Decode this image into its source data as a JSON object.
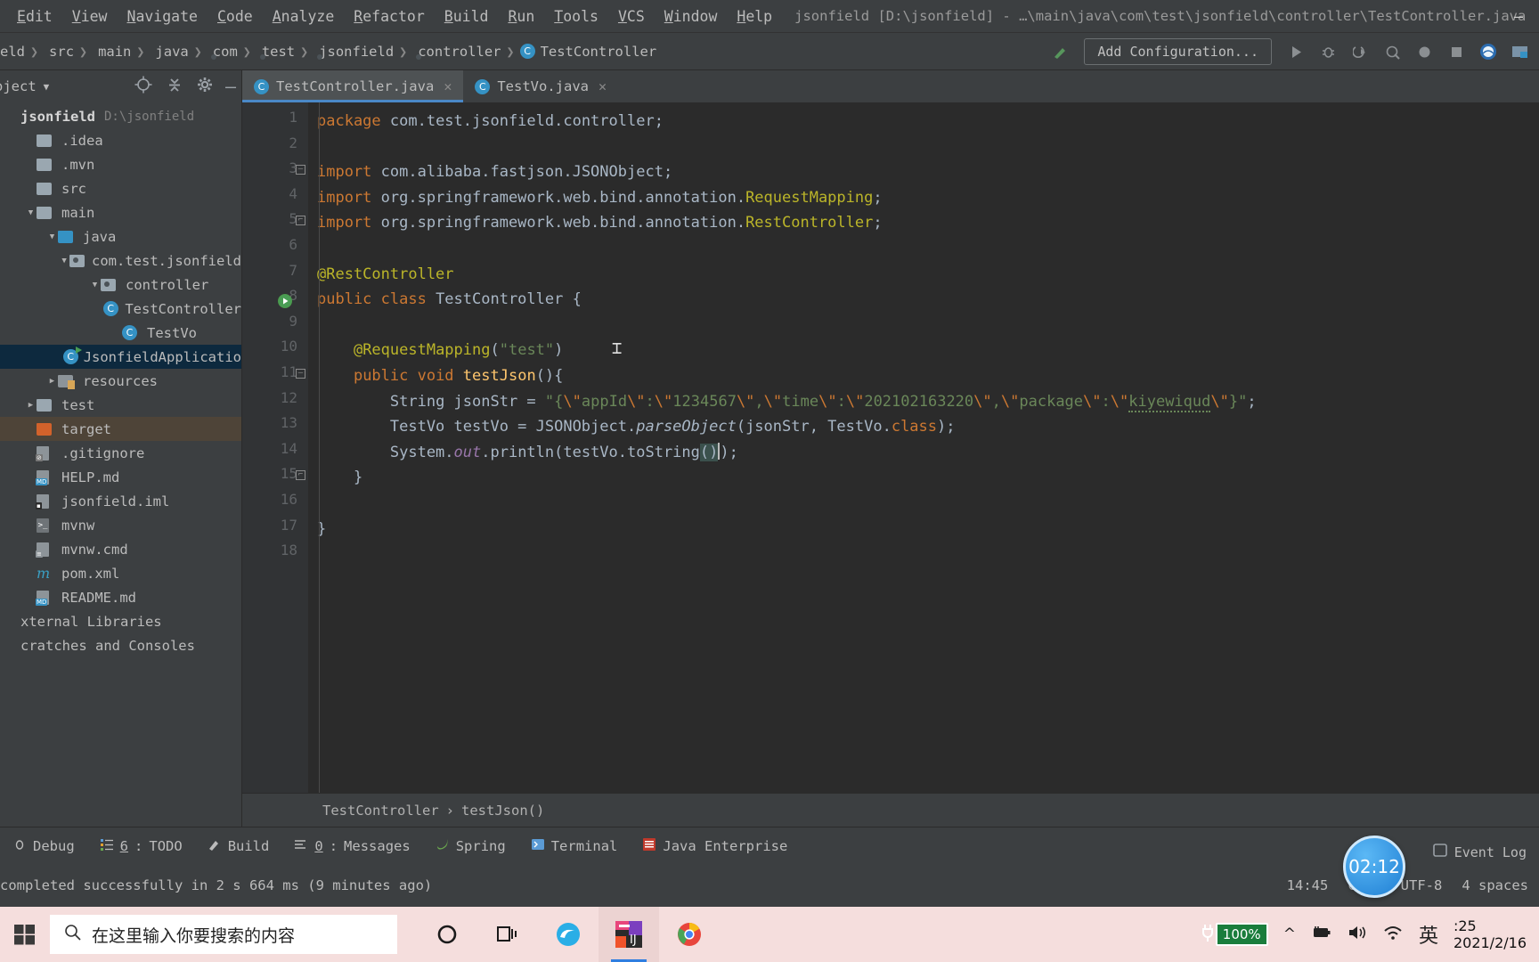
{
  "titlebar": {
    "menus": [
      "Edit",
      "View",
      "Navigate",
      "Code",
      "Analyze",
      "Refactor",
      "Build",
      "Run",
      "Tools",
      "VCS",
      "Window",
      "Help"
    ],
    "window_title": "jsonfield [D:\\jsonfield] - …\\main\\java\\com\\test\\jsonfield\\controller\\TestController.java",
    "minimize": "—"
  },
  "navbar": {
    "crumbs": [
      {
        "label": "eld",
        "icon": "none"
      },
      {
        "label": "src",
        "icon": "folder"
      },
      {
        "label": "main",
        "icon": "folder"
      },
      {
        "label": "java",
        "icon": "folder-blue"
      },
      {
        "label": "com",
        "icon": "package"
      },
      {
        "label": "test",
        "icon": "package"
      },
      {
        "label": "jsonfield",
        "icon": "package"
      },
      {
        "label": "controller",
        "icon": "package"
      },
      {
        "label": "TestController",
        "icon": "class"
      }
    ],
    "add_configuration": "Add Configuration...",
    "icons": [
      "build-hammer-icon",
      "run-icon",
      "debug-icon",
      "run-coverage-icon",
      "profile-icon",
      "record-icon",
      "stop-icon",
      "search-everywhere-icon",
      "project-structure-icon"
    ]
  },
  "sidebar": {
    "title": "oject",
    "header_icons": [
      "locate-icon",
      "collapse-all-icon",
      "settings-gear-icon",
      "hide-icon"
    ],
    "tree": [
      {
        "label": "jsonfield",
        "path": "D:\\jsonfield",
        "indent": 0,
        "arrow": "",
        "icon": "project",
        "sel": ""
      },
      {
        "label": ".idea",
        "indent": 1,
        "arrow": "",
        "icon": "folder",
        "sel": ""
      },
      {
        "label": ".mvn",
        "indent": 1,
        "arrow": "",
        "icon": "folder",
        "sel": ""
      },
      {
        "label": "src",
        "indent": 1,
        "arrow": "",
        "icon": "folder",
        "sel": ""
      },
      {
        "label": "main",
        "indent": 1,
        "arrow": "▼",
        "icon": "folder",
        "sel": ""
      },
      {
        "label": "java",
        "indent": 2,
        "arrow": "▼",
        "icon": "folder-blue",
        "sel": ""
      },
      {
        "label": "com.test.jsonfield",
        "indent": 3,
        "arrow": "▼",
        "icon": "package",
        "sel": ""
      },
      {
        "label": "controller",
        "indent": 4,
        "arrow": "▼",
        "icon": "package",
        "sel": ""
      },
      {
        "label": "TestController",
        "indent": 5,
        "arrow": "",
        "icon": "class",
        "sel": ""
      },
      {
        "label": "TestVo",
        "indent": 5,
        "arrow": "",
        "icon": "class",
        "sel": ""
      },
      {
        "label": "JsonfieldApplicatio",
        "indent": 5,
        "arrow": "",
        "icon": "class-run",
        "sel": "blue"
      },
      {
        "label": "resources",
        "indent": 2,
        "arrow": "▶",
        "icon": "folder-res",
        "sel": ""
      },
      {
        "label": "test",
        "indent": 1,
        "arrow": "▶",
        "icon": "folder",
        "sel": ""
      },
      {
        "label": "target",
        "indent": 1,
        "arrow": "",
        "icon": "folder-target",
        "sel": "brown"
      },
      {
        "label": ".gitignore",
        "indent": 1,
        "arrow": "",
        "icon": "file-git",
        "sel": ""
      },
      {
        "label": "HELP.md",
        "indent": 1,
        "arrow": "",
        "icon": "file-md",
        "sel": ""
      },
      {
        "label": "jsonfield.iml",
        "indent": 1,
        "arrow": "",
        "icon": "file-iml",
        "sel": ""
      },
      {
        "label": "mvnw",
        "indent": 1,
        "arrow": "",
        "icon": "file-sh",
        "sel": ""
      },
      {
        "label": "mvnw.cmd",
        "indent": 1,
        "arrow": "",
        "icon": "file-cmd",
        "sel": ""
      },
      {
        "label": "pom.xml",
        "indent": 1,
        "arrow": "",
        "icon": "file-maven",
        "sel": ""
      },
      {
        "label": "README.md",
        "indent": 1,
        "arrow": "",
        "icon": "file-md",
        "sel": ""
      },
      {
        "label": "xternal Libraries",
        "indent": 0,
        "arrow": "",
        "icon": "none",
        "sel": ""
      },
      {
        "label": "cratches and Consoles",
        "indent": 0,
        "arrow": "",
        "icon": "none",
        "sel": ""
      }
    ]
  },
  "editor": {
    "tabs": [
      {
        "label": "TestController.java",
        "icon": "class-icon",
        "active": true,
        "close": "✕"
      },
      {
        "label": "TestVo.java",
        "icon": "class-icon",
        "active": false,
        "close": "✕"
      }
    ],
    "line_numbers": [
      "1",
      "2",
      "3",
      "4",
      "5",
      "6",
      "7",
      "8",
      "9",
      "10",
      "11",
      "12",
      "13",
      "14",
      "15",
      "16",
      "17",
      "18"
    ],
    "code_lines": [
      "package com.test.jsonfield.controller;",
      "",
      "import com.alibaba.fastjson.JSONObject;",
      "import org.springframework.web.bind.annotation.RequestMapping;",
      "import org.springframework.web.bind.annotation.RestController;",
      "",
      "@RestController",
      "public class TestController {",
      "",
      "    @RequestMapping(\"test\")",
      "    public void testJson(){",
      "        String jsonStr = \"{\\\"appId\\\":\\\"1234567\\\",\\\"time\\\":\\\"202102163220\\\",\\\"package\\\":\\\"kiyewiqud\\\"}\";",
      "        TestVo testVo = JSONObject.parseObject(jsonStr, TestVo.class);",
      "        System.out.println(testVo.toString());",
      "    }",
      "",
      "}",
      ""
    ],
    "breadcrumb": [
      "TestController",
      "testJson()"
    ],
    "breadcrumb_sep": "›"
  },
  "toolwindows": [
    {
      "label": "Debug",
      "num": "",
      "icon": "debug-icon"
    },
    {
      "label": "TODO",
      "num": "6",
      "icon": "todo-icon"
    },
    {
      "label": "Build",
      "num": "",
      "icon": "build-icon"
    },
    {
      "label": "Messages",
      "num": "0",
      "icon": "messages-icon"
    },
    {
      "label": "Spring",
      "num": "",
      "icon": "spring-icon"
    },
    {
      "label": "Terminal",
      "num": "",
      "icon": "terminal-icon"
    },
    {
      "label": "Java Enterprise",
      "num": "",
      "icon": "java-enterprise-icon"
    }
  ],
  "statusbar": {
    "message": "completed successfully in 2 s 664 ms (9 minutes ago)",
    "time": "14:45",
    "line_sep": "CRLF",
    "encoding": "UTF-8",
    "indent": "4 spaces",
    "event_log": "Event Log"
  },
  "taskbar": {
    "search_placeholder": "在这里输入你要搜索的内容",
    "apps": [
      "cortana-icon",
      "task-view-icon",
      "edge-icon",
      "intellij-idea-icon",
      "chrome-icon"
    ],
    "tray": {
      "battery_percent": "100%",
      "chevron": "^",
      "icons": [
        "battery-icon",
        "volume-icon",
        "wifi-icon"
      ],
      "ime": "英",
      "time": ":25",
      "date": "2021/2/16"
    }
  },
  "overlay": {
    "recording_time": "02:12"
  }
}
